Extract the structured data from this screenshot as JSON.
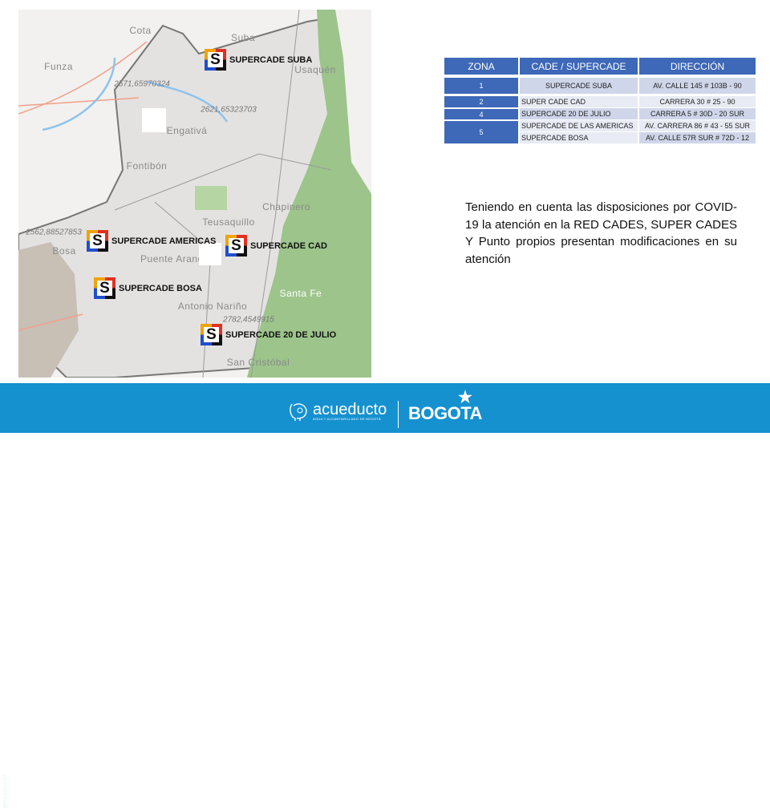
{
  "map": {
    "places": [
      "Cota",
      "Suba",
      "Funza",
      "Usaquén",
      "Engativá",
      "Fontibón",
      "Chapinero",
      "Teusaquillo",
      "Bosa",
      "Puente Aranda",
      "Santa Fe",
      "Antonio Nariño",
      "San Cristóbal"
    ],
    "coords": [
      "2571,65970324",
      "2621,65323703",
      "2562,88527853",
      "2782,4549915"
    ],
    "markers": [
      "SUPERCADE SUBA",
      "SUPERCADE AMERICAS",
      "SUPERCADE CAD",
      "SUPERCADE BOSA",
      "SUPERCADE 20 DE JULIO"
    ],
    "marker_icon": "supercade-s-icon",
    "colors": {
      "park": "#8fbf7a",
      "water": "#8ec3ee",
      "road": "#f0a08a"
    }
  },
  "table": {
    "headers": [
      "ZONA",
      "CADE / SUPERCADE",
      "DIRECCIÓN"
    ],
    "rows": [
      {
        "zona": "1",
        "cade": "SUPERCADE SUBA",
        "dir": "AV. CALLE 145 # 103B - 90"
      },
      {
        "zona": "2",
        "cade": "SUPER CADE CAD",
        "dir": "CARRERA 30 # 25 - 90"
      },
      {
        "zona": "4",
        "cade": "SUPERCADE 20 DE JULIO",
        "dir": "CARRERA 5 # 30D - 20 SUR"
      },
      {
        "zona": "5",
        "cade": "SUPERCADE DE LAS AMERICAS",
        "dir": "AV. CARRERA 86 # 43 - 55 SUR"
      },
      {
        "zona": "",
        "cade": "SUPERCADE BOSA",
        "dir": "AV. CALLE 57R SUR # 72D - 12"
      }
    ],
    "header_color": "#3e68b8"
  },
  "paragraph": "Teniendo en cuenta las disposiciones por COVID-19 la atención en la RED CADES, SUPER CADES Y Punto propios presentan modificaciones en su atención",
  "footer": {
    "color": "#1591d0",
    "code": "MPFD0801F07-03",
    "logo1_name": "acueducto",
    "logo1_sub": "AGUA Y ALCANTARILLADO DE BOGOTÁ",
    "logo2": "BOGOTA"
  }
}
